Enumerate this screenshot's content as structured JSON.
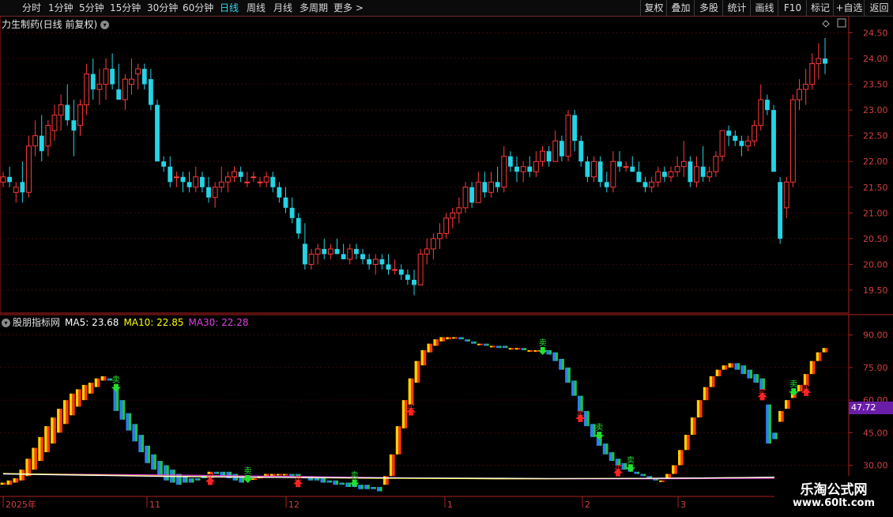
{
  "toolbar": {
    "periods": [
      "分时",
      "1分钟",
      "5分钟",
      "15分钟",
      "30分钟",
      "60分钟",
      "日线",
      "周线",
      "月线",
      "多周期",
      "更多 >"
    ],
    "active_period": "日线",
    "right_buttons": [
      "复权",
      "叠加",
      "多股",
      "统计",
      "画线",
      "F10",
      "标记",
      "+自选",
      "返回"
    ]
  },
  "stock": {
    "title": "力生制药(日线 前复权)",
    "collapse_icon": "chevron-down-icon"
  },
  "main_axis": {
    "labels": [
      "24.50",
      "24.00",
      "23.50",
      "23.00",
      "22.50",
      "22.00",
      "21.50",
      "21.00",
      "20.50",
      "20.00",
      "19.50"
    ],
    "values": [
      24.5,
      24.0,
      23.5,
      23.0,
      22.5,
      22.0,
      21.5,
      21.0,
      20.5,
      20.0,
      19.5
    ]
  },
  "indicator": {
    "name": "股朋指标网",
    "ma5_label": "MA5: 23.68",
    "ma10_label": "MA10: 22.85",
    "ma30_label": "MA30: 22.28",
    "axis_labels": [
      "90.00",
      "75.00",
      "60.00",
      "45.00",
      "30.00"
    ],
    "axis_values": [
      90,
      75,
      60,
      45,
      30
    ],
    "current_value": "47.72",
    "buy_label": "买",
    "sell_label": "卖"
  },
  "time_axis": {
    "labels": [
      "2025年",
      "11",
      "12",
      "1",
      "2",
      "3"
    ]
  },
  "watermark": {
    "line1": "乐淘公式网",
    "line2": "www.60lt.com"
  },
  "colors": {
    "up": "#ff3a3a",
    "down": "#22d4e6",
    "ma5": "#ffffff",
    "ma10": "#ffff00",
    "ma30": "#e040e0",
    "bar_up_a": "#ffd000",
    "bar_up_b": "#ff3a00",
    "bar_dn_a": "#2e7dff",
    "bar_dn_b": "#22c050",
    "axis_red": "#b02020"
  },
  "chart_data": {
    "type": "candlestick",
    "y_range": [
      19.3,
      24.6
    ],
    "indicator_range": [
      20,
      95
    ],
    "candles": [
      [
        21.6,
        21.8,
        21.5,
        21.7
      ],
      [
        21.7,
        21.9,
        21.5,
        21.6
      ],
      [
        21.4,
        21.6,
        21.2,
        21.5
      ],
      [
        21.6,
        22.0,
        21.2,
        21.4
      ],
      [
        21.4,
        22.5,
        21.3,
        22.3
      ],
      [
        22.3,
        22.8,
        22.1,
        22.5
      ],
      [
        22.5,
        22.9,
        22.0,
        22.2
      ],
      [
        22.3,
        22.8,
        22.1,
        22.7
      ],
      [
        22.6,
        23.1,
        22.4,
        22.9
      ],
      [
        22.9,
        23.3,
        22.6,
        23.1
      ],
      [
        23.1,
        23.5,
        22.7,
        22.8
      ],
      [
        22.8,
        23.2,
        22.1,
        22.6
      ],
      [
        22.7,
        23.2,
        22.5,
        23.1
      ],
      [
        23.1,
        23.9,
        22.9,
        23.7
      ],
      [
        23.7,
        24.0,
        23.2,
        23.4
      ],
      [
        23.4,
        23.8,
        23.1,
        23.5
      ],
      [
        23.5,
        24.0,
        23.2,
        23.8
      ],
      [
        23.8,
        24.1,
        23.4,
        23.5
      ],
      [
        23.4,
        23.9,
        23.2,
        23.2
      ],
      [
        23.2,
        23.7,
        23.0,
        23.6
      ],
      [
        23.5,
        24.0,
        23.3,
        23.6
      ],
      [
        23.7,
        23.9,
        23.4,
        23.8
      ],
      [
        23.8,
        23.9,
        23.4,
        23.5
      ],
      [
        23.6,
        23.8,
        23.0,
        23.1
      ],
      [
        23.1,
        23.2,
        22.0,
        22.0
      ],
      [
        22.0,
        22.1,
        21.8,
        21.9
      ],
      [
        21.9,
        22.1,
        21.5,
        21.6
      ],
      [
        21.7,
        21.8,
        21.5,
        21.7
      ],
      [
        21.7,
        21.8,
        21.4,
        21.6
      ],
      [
        21.6,
        21.8,
        21.4,
        21.5
      ],
      [
        21.5,
        21.9,
        21.4,
        21.7
      ],
      [
        21.7,
        21.8,
        21.4,
        21.5
      ],
      [
        21.5,
        21.7,
        21.2,
        21.3
      ],
      [
        21.3,
        21.6,
        21.1,
        21.5
      ],
      [
        21.5,
        21.9,
        21.4,
        21.6
      ],
      [
        21.6,
        21.8,
        21.4,
        21.7
      ],
      [
        21.7,
        21.9,
        21.6,
        21.8
      ],
      [
        21.8,
        21.9,
        21.6,
        21.7
      ],
      [
        21.6,
        21.8,
        21.5,
        21.6
      ],
      [
        21.7,
        21.8,
        21.6,
        21.7
      ],
      [
        21.6,
        21.7,
        21.5,
        21.6
      ],
      [
        21.6,
        21.8,
        21.5,
        21.7
      ],
      [
        21.7,
        21.8,
        21.4,
        21.5
      ],
      [
        21.5,
        21.6,
        21.2,
        21.3
      ],
      [
        21.3,
        21.5,
        21.0,
        21.1
      ],
      [
        21.1,
        21.3,
        20.8,
        20.9
      ],
      [
        20.9,
        21.0,
        20.5,
        20.6
      ],
      [
        20.4,
        20.8,
        19.9,
        20.0
      ],
      [
        20.0,
        20.3,
        19.9,
        20.2
      ],
      [
        20.2,
        20.4,
        20.0,
        20.3
      ],
      [
        20.3,
        20.5,
        20.1,
        20.2
      ],
      [
        20.2,
        20.4,
        20.1,
        20.3
      ],
      [
        20.3,
        20.5,
        20.2,
        20.2
      ],
      [
        20.2,
        20.4,
        20.1,
        20.1
      ],
      [
        20.1,
        20.4,
        20.0,
        20.3
      ],
      [
        20.3,
        20.4,
        20.1,
        20.2
      ],
      [
        20.2,
        20.3,
        20.0,
        20.1
      ],
      [
        20.1,
        20.2,
        19.9,
        20.0
      ],
      [
        20.0,
        20.2,
        19.8,
        20.1
      ],
      [
        20.1,
        20.2,
        19.9,
        20.0
      ],
      [
        20.0,
        20.2,
        19.8,
        19.9
      ],
      [
        19.9,
        20.1,
        19.8,
        19.9
      ],
      [
        19.9,
        20.0,
        19.7,
        19.8
      ],
      [
        19.8,
        19.9,
        19.6,
        19.7
      ],
      [
        19.7,
        19.9,
        19.4,
        19.6
      ],
      [
        19.6,
        20.3,
        19.6,
        20.2
      ],
      [
        20.2,
        20.5,
        20.0,
        20.3
      ],
      [
        20.3,
        20.6,
        20.1,
        20.5
      ],
      [
        20.5,
        20.8,
        20.3,
        20.6
      ],
      [
        20.6,
        21.0,
        20.5,
        20.9
      ],
      [
        20.9,
        21.1,
        20.7,
        21.0
      ],
      [
        21.0,
        21.3,
        20.8,
        21.1
      ],
      [
        21.1,
        21.6,
        21.0,
        21.5
      ],
      [
        21.5,
        21.6,
        21.1,
        21.2
      ],
      [
        21.2,
        21.8,
        21.2,
        21.6
      ],
      [
        21.6,
        21.8,
        21.3,
        21.4
      ],
      [
        21.4,
        21.8,
        21.3,
        21.6
      ],
      [
        21.6,
        21.9,
        21.4,
        21.5
      ],
      [
        21.5,
        22.3,
        21.4,
        22.1
      ],
      [
        22.1,
        22.2,
        21.8,
        21.9
      ],
      [
        21.9,
        22.1,
        21.6,
        21.8
      ],
      [
        21.8,
        22.0,
        21.6,
        21.9
      ],
      [
        21.9,
        22.1,
        21.7,
        21.8
      ],
      [
        21.8,
        22.2,
        21.7,
        22.0
      ],
      [
        22.0,
        22.3,
        21.9,
        22.2
      ],
      [
        22.2,
        22.3,
        21.9,
        22.0
      ],
      [
        22.0,
        22.6,
        22.0,
        22.4
      ],
      [
        22.4,
        22.5,
        22.0,
        22.1
      ],
      [
        22.1,
        23.0,
        22.0,
        22.9
      ],
      [
        22.9,
        23.0,
        22.2,
        22.4
      ],
      [
        22.4,
        22.5,
        21.9,
        22.0
      ],
      [
        22.0,
        22.1,
        21.6,
        21.7
      ],
      [
        21.7,
        22.1,
        21.6,
        22.0
      ],
      [
        22.0,
        22.1,
        21.5,
        21.6
      ],
      [
        21.6,
        21.8,
        21.4,
        21.5
      ],
      [
        21.5,
        22.2,
        21.4,
        22.0
      ],
      [
        22.0,
        22.2,
        21.8,
        21.9
      ],
      [
        21.9,
        22.0,
        21.8,
        21.9
      ],
      [
        21.9,
        22.1,
        21.8,
        21.8
      ],
      [
        21.8,
        22.0,
        21.6,
        21.6
      ],
      [
        21.6,
        21.7,
        21.4,
        21.5
      ],
      [
        21.5,
        21.7,
        21.4,
        21.6
      ],
      [
        21.6,
        21.9,
        21.5,
        21.8
      ],
      [
        21.8,
        21.9,
        21.6,
        21.7
      ],
      [
        21.7,
        21.9,
        21.6,
        21.8
      ],
      [
        21.8,
        22.1,
        21.7,
        21.9
      ],
      [
        21.9,
        22.4,
        21.7,
        22.0
      ],
      [
        22.0,
        22.1,
        21.5,
        21.6
      ],
      [
        21.6,
        22.1,
        21.5,
        21.9
      ],
      [
        21.9,
        22.3,
        21.6,
        21.7
      ],
      [
        21.7,
        21.9,
        21.6,
        21.8
      ],
      [
        21.8,
        22.2,
        21.7,
        22.1
      ],
      [
        22.1,
        22.6,
        22.0,
        22.6
      ],
      [
        22.6,
        22.7,
        22.3,
        22.5
      ],
      [
        22.5,
        22.6,
        22.3,
        22.4
      ],
      [
        22.4,
        22.5,
        22.1,
        22.3
      ],
      [
        22.3,
        22.5,
        22.2,
        22.4
      ],
      [
        22.4,
        22.8,
        22.3,
        22.7
      ],
      [
        22.7,
        23.5,
        22.6,
        23.2
      ],
      [
        23.2,
        23.3,
        22.9,
        23.0
      ],
      [
        23.0,
        23.1,
        21.8,
        21.8
      ],
      [
        21.6,
        21.7,
        20.4,
        20.5
      ],
      [
        21.1,
        21.7,
        20.9,
        21.6
      ],
      [
        21.6,
        23.3,
        21.5,
        23.2
      ],
      [
        23.2,
        23.6,
        23.0,
        23.4
      ],
      [
        23.4,
        23.8,
        23.1,
        23.5
      ],
      [
        23.5,
        24.1,
        23.4,
        23.9
      ],
      [
        23.9,
        24.3,
        23.6,
        24.0
      ],
      [
        24.0,
        24.4,
        23.7,
        23.9
      ]
    ],
    "indicator_bars": [
      [
        21,
        22
      ],
      [
        21,
        23
      ],
      [
        22,
        24
      ],
      [
        23,
        28
      ],
      [
        25,
        33
      ],
      [
        28,
        38
      ],
      [
        32,
        43
      ],
      [
        36,
        48
      ],
      [
        40,
        52
      ],
      [
        45,
        56
      ],
      [
        49,
        60
      ],
      [
        53,
        63
      ],
      [
        57,
        65
      ],
      [
        60,
        67
      ],
      [
        63,
        68
      ],
      [
        66,
        70
      ],
      [
        69,
        71
      ],
      [
        70,
        69
      ],
      [
        66,
        55
      ],
      [
        60,
        51
      ],
      [
        54,
        46
      ],
      [
        49,
        41
      ],
      [
        44,
        36
      ],
      [
        39,
        31
      ],
      [
        35,
        28
      ],
      [
        32,
        25
      ],
      [
        30,
        23
      ],
      [
        28,
        22
      ],
      [
        26,
        21
      ],
      [
        25,
        22
      ],
      [
        24,
        22
      ],
      [
        24,
        23
      ],
      [
        25,
        24
      ],
      [
        26,
        27
      ],
      [
        27,
        26
      ],
      [
        27,
        25
      ],
      [
        27,
        24
      ],
      [
        26,
        23
      ],
      [
        25,
        22
      ],
      [
        24,
        23
      ],
      [
        24,
        24
      ],
      [
        24,
        25
      ],
      [
        25,
        26
      ],
      [
        25,
        26
      ],
      [
        26,
        26
      ],
      [
        26,
        26
      ],
      [
        26,
        25
      ],
      [
        26,
        25
      ],
      [
        25,
        24
      ],
      [
        25,
        23
      ],
      [
        24,
        23
      ],
      [
        24,
        22
      ],
      [
        23,
        22
      ],
      [
        23,
        21
      ],
      [
        22,
        21
      ],
      [
        22,
        20
      ],
      [
        22,
        20
      ],
      [
        21,
        19
      ],
      [
        21,
        19
      ],
      [
        20,
        19
      ],
      [
        20,
        18
      ],
      [
        21,
        25
      ],
      [
        25,
        35
      ],
      [
        35,
        48
      ],
      [
        47,
        60
      ],
      [
        58,
        70
      ],
      [
        68,
        78
      ],
      [
        76,
        83
      ],
      [
        82,
        86
      ],
      [
        85,
        88
      ],
      [
        87,
        89
      ],
      [
        88,
        89
      ],
      [
        89,
        89
      ],
      [
        89,
        88
      ],
      [
        88,
        87
      ],
      [
        87,
        86
      ],
      [
        86,
        86
      ],
      [
        86,
        85
      ],
      [
        85,
        85
      ],
      [
        85,
        84
      ],
      [
        85,
        84
      ],
      [
        84,
        84
      ],
      [
        84,
        84
      ],
      [
        84,
        83
      ],
      [
        83,
        83
      ],
      [
        83,
        83
      ],
      [
        83,
        82
      ],
      [
        83,
        81
      ],
      [
        82,
        78
      ],
      [
        79,
        74
      ],
      [
        75,
        68
      ],
      [
        69,
        62
      ],
      [
        62,
        55
      ],
      [
        55,
        48
      ],
      [
        49,
        43
      ],
      [
        44,
        39
      ],
      [
        40,
        35
      ],
      [
        36,
        32
      ],
      [
        33,
        30
      ],
      [
        31,
        28
      ],
      [
        29,
        27
      ],
      [
        27,
        26
      ],
      [
        26,
        25
      ],
      [
        25,
        24
      ],
      [
        24,
        23
      ],
      [
        23,
        23
      ],
      [
        24,
        26
      ],
      [
        26,
        30
      ],
      [
        30,
        37
      ],
      [
        37,
        44
      ],
      [
        44,
        52
      ],
      [
        52,
        60
      ],
      [
        60,
        66
      ],
      [
        66,
        71
      ],
      [
        71,
        74
      ],
      [
        74,
        76
      ],
      [
        75,
        77
      ],
      [
        77,
        74
      ],
      [
        76,
        72
      ],
      [
        74,
        70
      ],
      [
        72,
        68
      ],
      [
        70,
        65
      ],
      [
        58,
        40
      ],
      [
        45,
        42
      ],
      [
        50,
        55
      ],
      [
        56,
        60
      ],
      [
        61,
        64
      ],
      [
        64,
        67
      ],
      [
        67,
        72
      ],
      [
        72,
        78
      ],
      [
        78,
        82
      ],
      [
        82,
        84
      ]
    ],
    "ma5": [
      26,
      25.6,
      25.2,
      24.8,
      24.6,
      24.4,
      24.3,
      24.2,
      24.1,
      24.0,
      23.9,
      23.9,
      24.0,
      24.2,
      24.5,
      24.8
    ],
    "ma10": [
      26.2,
      25.8,
      25.4,
      25.0,
      24.7,
      24.4,
      24.2,
      24.0,
      23.9,
      23.8,
      23.8,
      23.9,
      24.0,
      24.2,
      24.4,
      24.6
    ],
    "ma30": [
      26.0,
      25.9,
      25.7,
      25.5,
      25.2,
      24.9,
      24.6,
      24.3,
      24.0,
      23.8,
      23.7,
      23.7,
      23.8,
      23.9,
      24.0,
      24.2
    ],
    "signals": [
      {
        "type": "sell",
        "bar": 18
      },
      {
        "type": "buy",
        "bar": 33
      },
      {
        "type": "sell",
        "bar": 39
      },
      {
        "type": "buy",
        "bar": 47
      },
      {
        "type": "sell",
        "bar": 56
      },
      {
        "type": "buy",
        "bar": 65
      },
      {
        "type": "sell",
        "bar": 86
      },
      {
        "type": "buy",
        "bar": 92
      },
      {
        "type": "sell",
        "bar": 95
      },
      {
        "type": "buy",
        "bar": 98
      },
      {
        "type": "sell",
        "bar": 100
      },
      {
        "type": "buy",
        "bar": 121
      },
      {
        "type": "sell",
        "bar": 126
      },
      {
        "type": "buy",
        "bar": 128
      },
      {
        "type": "sell",
        "bar": 140
      },
      {
        "type": "buy",
        "bar": 144
      }
    ]
  }
}
